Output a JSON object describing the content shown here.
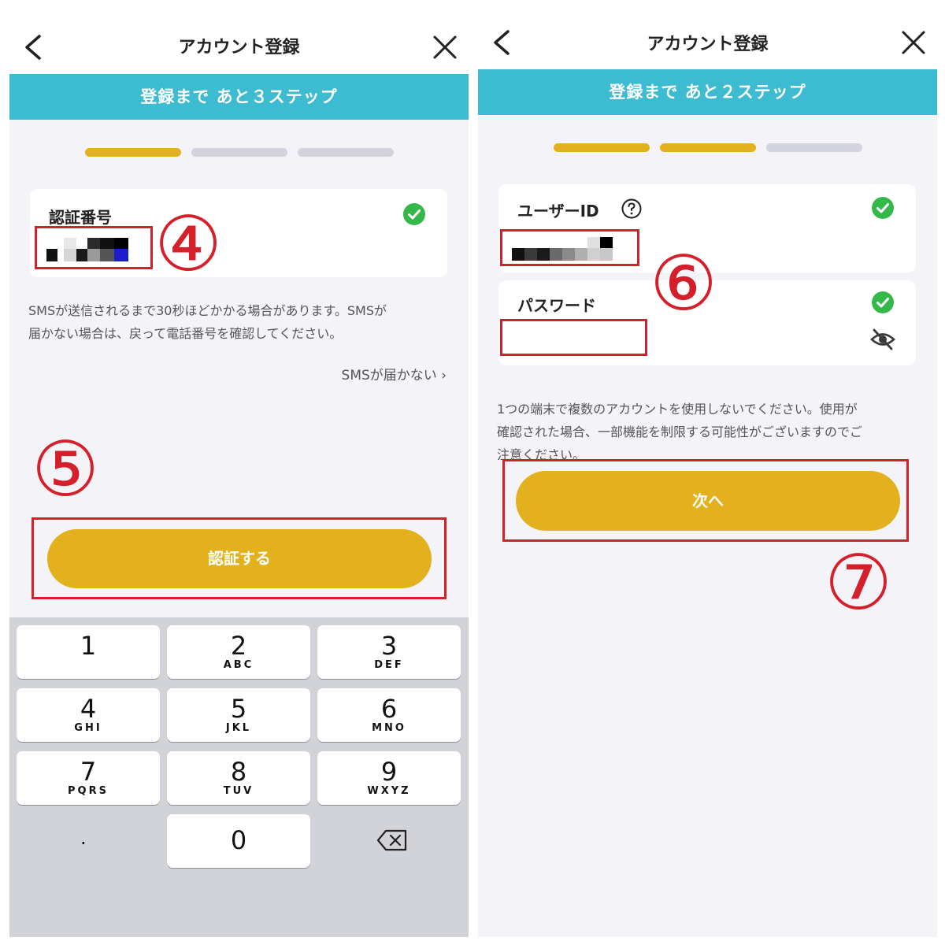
{
  "left_screen": {
    "nav_title": "アカウント登録",
    "banner": "登録まで あと３ステップ",
    "progress": {
      "completed": 1,
      "total": 3
    },
    "field": {
      "label": "認証番号"
    },
    "annotation_field": "④",
    "notice": [
      "SMSが送信されるまで30秒ほどかかる場合があります。SMSが",
      "届かない場合は、戻って電話番号を確認してください。"
    ],
    "sms_link": "SMSが届かない ›",
    "annotation_button": "⑤",
    "submit_label": "認証する",
    "keypad": {
      "keys": [
        {
          "num": "1",
          "letters": ""
        },
        {
          "num": "2",
          "letters": "ABC"
        },
        {
          "num": "3",
          "letters": "DEF"
        },
        {
          "num": "4",
          "letters": "GHI"
        },
        {
          "num": "5",
          "letters": "JKL"
        },
        {
          "num": "6",
          "letters": "MNO"
        },
        {
          "num": "7",
          "letters": "PQRS"
        },
        {
          "num": "8",
          "letters": "TUV"
        },
        {
          "num": "9",
          "letters": "WXYZ"
        }
      ],
      "dot": ".",
      "zero": "0"
    }
  },
  "right_screen": {
    "nav_title": "アカウント登録",
    "banner": "登録まで あと２ステップ",
    "progress": {
      "completed": 2,
      "total": 3
    },
    "userid_label": "ユーザーID",
    "password_label": "パスワード",
    "annotation_fields": "⑥",
    "notice": [
      "1つの端末で複数のアカウントを使用しないでください。使用が",
      "確認された場合、一部機能を制限する可能性がございますのでご",
      "注意ください。"
    ],
    "next_label": "次へ",
    "annotation_button": "⑦"
  },
  "colors": {
    "banner": "#3dbcd1",
    "accent": "#e2b11d",
    "check": "#35b84a",
    "annotation": "#d4202a"
  }
}
